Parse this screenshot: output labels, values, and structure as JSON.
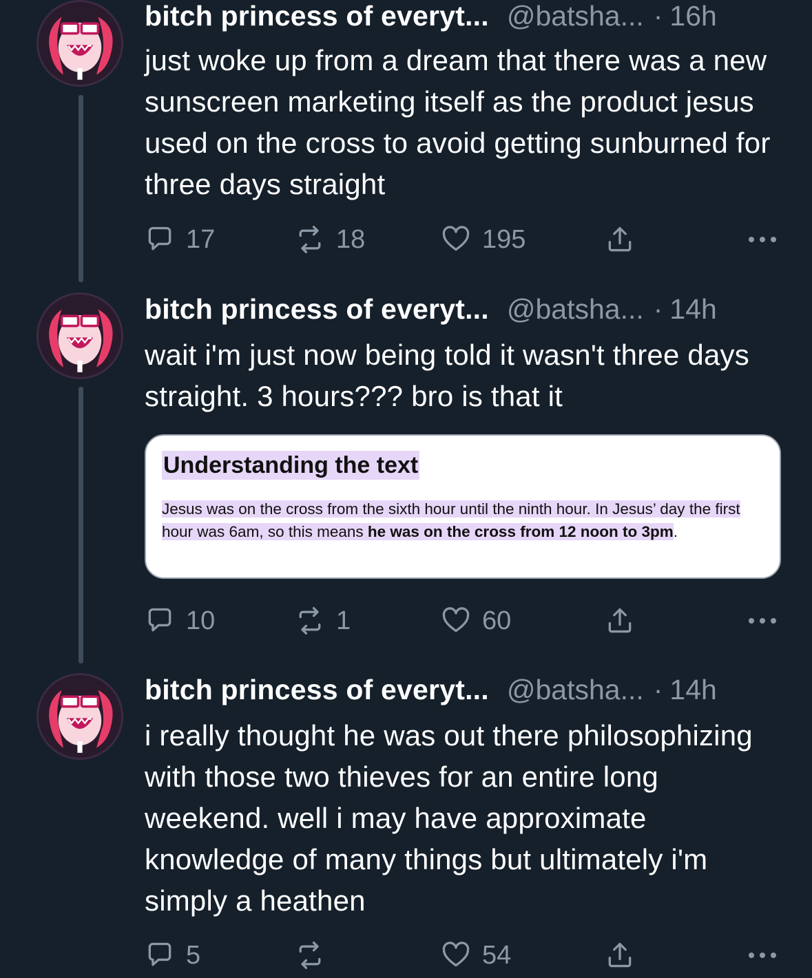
{
  "colors": {
    "background": "#15202b",
    "muted": "#8b98a5",
    "thread_line": "#3d4b5a",
    "highlight": "#e6d6f7"
  },
  "tweets": [
    {
      "name": "bitch princess of everyt...",
      "handle": "@batsha...",
      "separator": "·",
      "time": "16h",
      "text": "just woke up from a dream that there was a new sunscreen marketing itself as the product jesus used on the cross to avoid getting sunburned for three days straight",
      "replies": "17",
      "retweets": "18",
      "likes": "195"
    },
    {
      "name": "bitch princess of everyt...",
      "handle": "@batsha...",
      "separator": "·",
      "time": "14h",
      "text": "wait i'm just now being told it wasn't three days straight. 3 hours??? bro is that it",
      "replies": "10",
      "retweets": "1",
      "likes": "60",
      "card": {
        "title": "Understanding the text",
        "body_plain": "Jesus was on the cross from the sixth hour until the ninth hour. In Jesus’ day the first hour was 6am, so this means ",
        "body_bold": "he was on the cross from 12 noon to 3pm",
        "body_end": "."
      }
    },
    {
      "name": "bitch princess of everyt...",
      "handle": "@batsha...",
      "separator": "·",
      "time": "14h",
      "text": "i really thought he was out there philosophizing with those two thieves for an entire long weekend. well i may have approximate knowledge of many things but ultimately i'm simply a heathen",
      "replies": "5",
      "retweets": "",
      "likes": "54"
    }
  ],
  "icons": {
    "reply": "reply-icon",
    "retweet": "retweet-icon",
    "like": "heart-icon",
    "share": "share-icon",
    "more": "more-icon"
  }
}
